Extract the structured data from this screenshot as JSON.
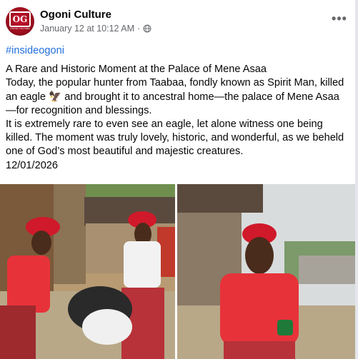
{
  "post": {
    "page_name": "Ogoni Culture",
    "timestamp": "January 12 at 10:12 AM",
    "separator": "·",
    "audience_icon": "globe-icon",
    "more_icon": "more-horizontal-icon",
    "more_label": "•••",
    "avatar_text": "OG",
    "avatar_caption": "OGONI CULTURE",
    "hashtag": "#insideogoni",
    "paragraphs": [
      "A Rare and Historic Moment at the Palace of Mene Asaa",
      "Today, the popular hunter from Taabaa, fondly known as Spirit Man, killed an eagle 🦅 and brought it to ancestral home—the palace of Mene Asaa—for recognition and blessings.",
      "It is extremely rare to even see an eagle, let alone witness one being killed. The moment was truly lovely, historic, and wonderful, as we beheld one of God’s most beautiful and majestic creatures.",
      "12/01/2026"
    ]
  },
  "colors": {
    "hashtag": "#216fdb",
    "meta_text": "#65676b",
    "avatar_red": "#c8102e"
  }
}
